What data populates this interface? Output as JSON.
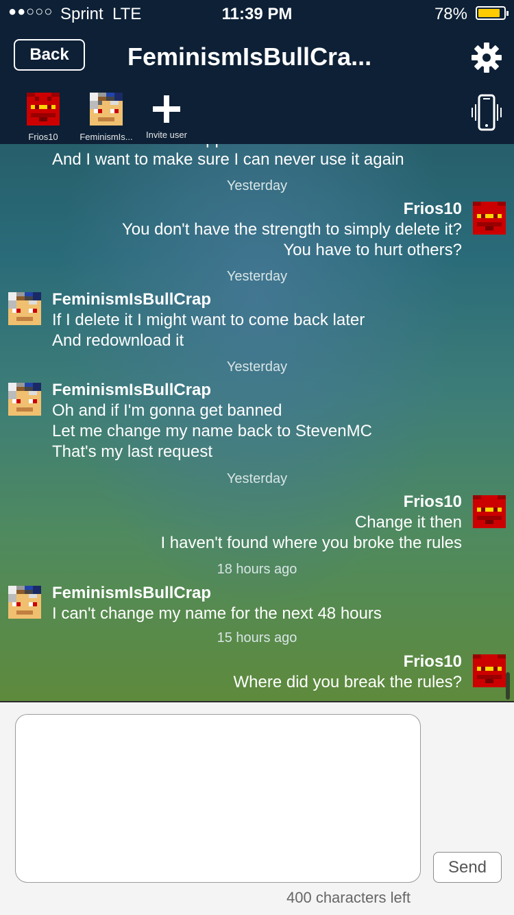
{
  "status_bar": {
    "signal": "●●○○○",
    "carrier": "Sprint",
    "network": "LTE",
    "time": "11:39 PM",
    "battery": "78%"
  },
  "header": {
    "back_label": "Back",
    "title": "FeminismIsBullCra..."
  },
  "participants": [
    {
      "label": "Frios10"
    },
    {
      "label": "FeminismIs..."
    },
    {
      "label": "Invite user"
    }
  ],
  "chat": {
    "partial": {
      "line1": "Because I hate this app",
      "line2": "And I want to make sure I can never use it again"
    },
    "timestamps": [
      "Yesterday",
      "Yesterday",
      "Yesterday",
      "Yesterday",
      "18 hours ago",
      "15 hours ago"
    ],
    "messages": [
      {
        "name": "Frios10",
        "lines": [
          "You don't have the strength to simply delete it?",
          "You have to hurt others?"
        ]
      },
      {
        "name": "FeminismIsBullCrap",
        "lines": [
          "If I delete it I might want to come back later",
          "And redownload it"
        ]
      },
      {
        "name": "FeminismIsBullCrap",
        "lines": [
          "Oh and if I'm gonna get banned",
          "Let me change my name back to StevenMC",
          "That's my last request"
        ]
      },
      {
        "name": "Frios10",
        "lines": [
          "Change it then",
          "I haven't found where you broke the rules"
        ]
      },
      {
        "name": "FeminismIsBullCrap",
        "lines": [
          "I can't change my name for the next 48 hours"
        ]
      },
      {
        "name": "Frios10",
        "lines": [
          "Where did you break the rules?"
        ]
      }
    ]
  },
  "compose": {
    "value": "",
    "send_label": "Send",
    "chars_left": "400 characters left"
  },
  "colors": {
    "header": "#0d2036",
    "battery": "#ffcc00",
    "avatar_frios": "#cc0000",
    "avatar_other_skin": "#f0c070"
  }
}
